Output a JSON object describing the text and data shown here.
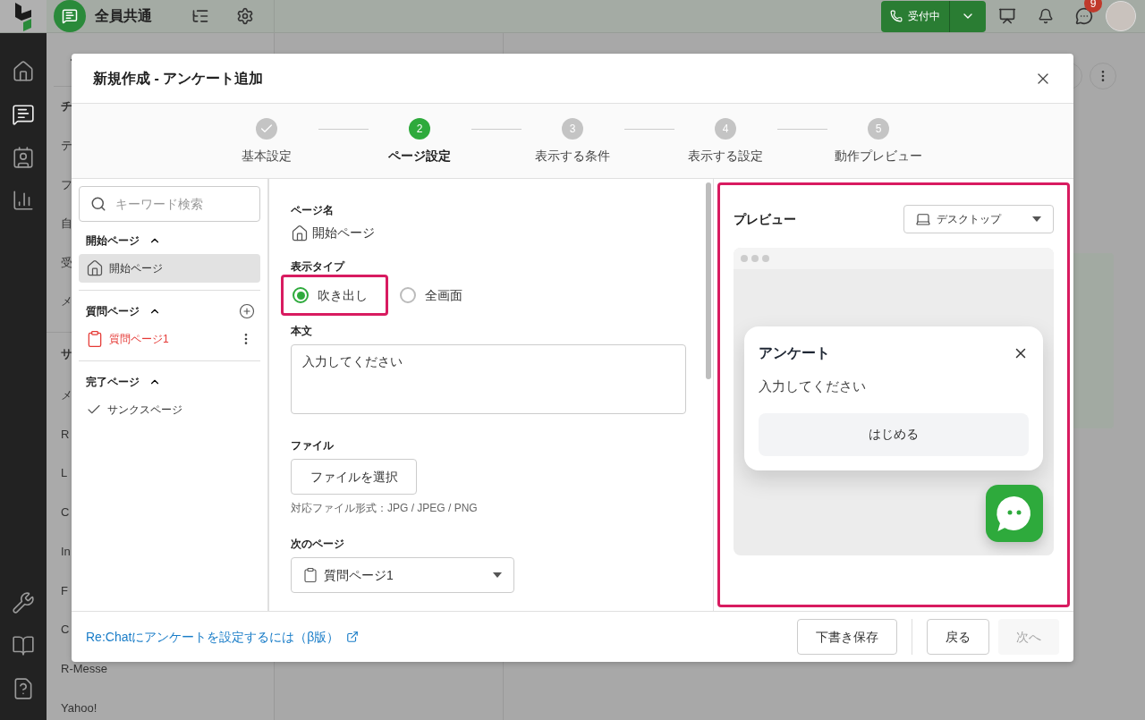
{
  "topbar": {
    "workspace": "全員共通",
    "status_button": "受付中",
    "badge": "9"
  },
  "background_list": {
    "sections": [
      {
        "heading": "チ",
        "items": [
          "テ",
          "フ",
          "自",
          "受",
          "メ"
        ]
      },
      {
        "heading": "サ",
        "items": [
          "メ",
          "R",
          "L",
          "C",
          "In",
          "F",
          "C",
          "R-Messe",
          "Yahoo!"
        ]
      }
    ]
  },
  "modal": {
    "title": "新規作成 - アンケート追加",
    "steps": [
      {
        "label": "基本設定",
        "done": true,
        "selected": false
      },
      {
        "number": "2",
        "label": "ページ設定",
        "done": false,
        "selected": true
      },
      {
        "number": "3",
        "label": "表示する条件",
        "done": false,
        "selected": false
      },
      {
        "number": "4",
        "label": "表示する設定",
        "done": false,
        "selected": false
      },
      {
        "number": "5",
        "label": "動作プレビュー",
        "done": false,
        "selected": false
      }
    ],
    "sidebar": {
      "search": {
        "placeholder": "キーワード検索"
      },
      "sections": [
        {
          "heading": "開始ページ",
          "expanded": true,
          "can_add": false,
          "items": [
            {
              "kind": "home",
              "label": "開始ページ",
              "selected": true,
              "error": false,
              "has_menu": false
            }
          ]
        },
        {
          "heading": "質問ページ",
          "expanded": true,
          "can_add": true,
          "items": [
            {
              "kind": "clipboard",
              "label": "質問ページ1",
              "selected": false,
              "error": true,
              "has_menu": true
            }
          ]
        },
        {
          "heading": "完了ページ",
          "expanded": true,
          "can_add": false,
          "items": [
            {
              "kind": "check",
              "label": "サンクスページ",
              "selected": false,
              "error": false,
              "has_menu": false
            }
          ]
        }
      ]
    },
    "form": {
      "page_name": {
        "label": "ページ名",
        "value": "開始ページ"
      },
      "display_type": {
        "label": "表示タイプ",
        "options": [
          {
            "label": "吹き出し",
            "selected": true,
            "highlighted": true
          },
          {
            "label": "全画面",
            "selected": false,
            "highlighted": false
          }
        ]
      },
      "body": {
        "label": "本文",
        "value": "入力してください"
      },
      "file": {
        "label": "ファイル",
        "button": "ファイルを選択",
        "note": "対応ファイル形式：JPG / JPEG / PNG"
      },
      "next_page": {
        "label": "次のページ",
        "value": "質問ページ1"
      }
    },
    "preview": {
      "title": "プレビュー",
      "highlighted": true,
      "device": "デスクトップ",
      "popup": {
        "title": "アンケート",
        "text": "入力してください",
        "button": "はじめる"
      }
    },
    "footer": {
      "link": "Re:Chatにアンケートを設定するには（β版）",
      "buttons": [
        {
          "label": "下書き保存",
          "disabled": false
        },
        {
          "label": "戻る",
          "disabled": false
        },
        {
          "label": "次へ",
          "disabled": true
        }
      ]
    }
  }
}
